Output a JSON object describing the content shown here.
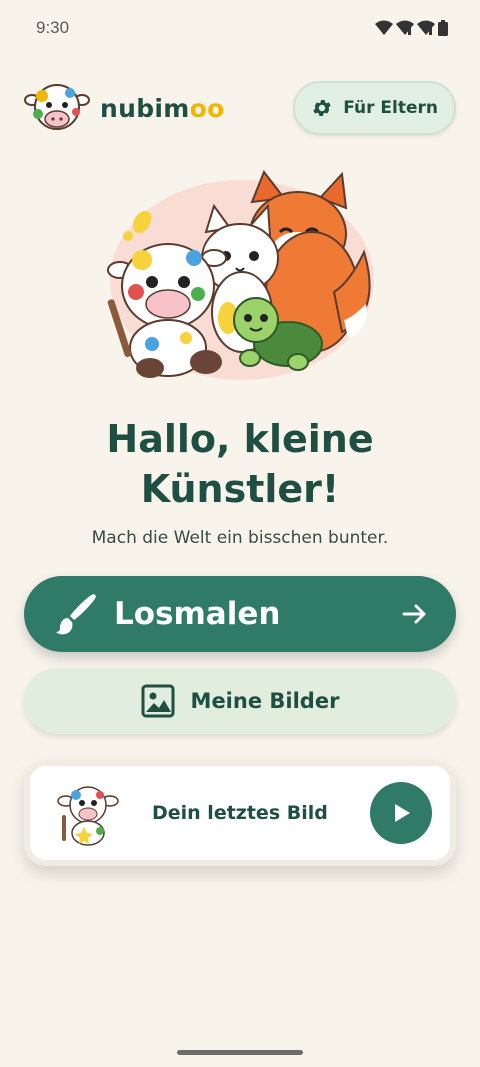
{
  "status": {
    "time": "9:30"
  },
  "brand": {
    "name_main": "nubim",
    "name_accent": "oo"
  },
  "header": {
    "parents_label": "Für Eltern"
  },
  "hero": {
    "title_line1": "Hallo, kleine",
    "title_line2": "Künstler!",
    "subtitle": "Mach die Welt ein bisschen bunter."
  },
  "actions": {
    "paint_label": "Losmalen",
    "gallery_label": "Meine Bilder"
  },
  "last_picture": {
    "label": "Dein letztes Bild"
  },
  "colors": {
    "primary": "#2f7b67",
    "secondary_bg": "#e1eedd",
    "text": "#1f4f43",
    "accent": "#f2b500",
    "background": "#f8f4ec"
  },
  "icons": [
    "wifi-icon",
    "signal-icon",
    "battery-icon",
    "gear-icon",
    "brush-icon",
    "arrow-right-icon",
    "image-icon",
    "play-icon"
  ]
}
